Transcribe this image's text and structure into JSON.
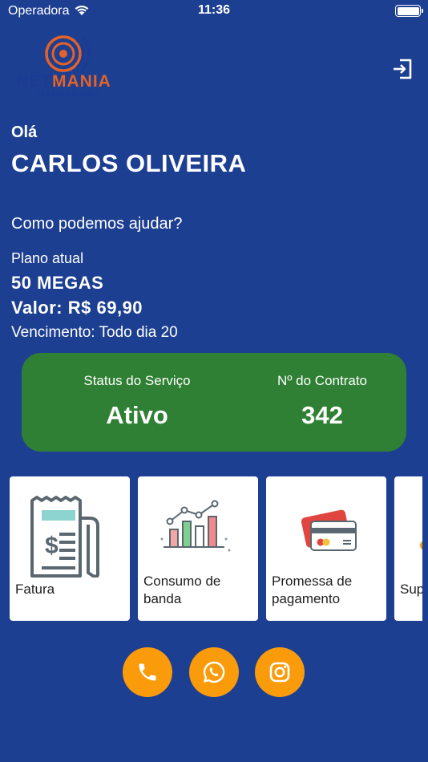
{
  "status_bar": {
    "carrier": "Operadora",
    "time": "11:36"
  },
  "logo": {
    "primary": "NET",
    "accent": "MANIA",
    "sub": "MANGABEIRA"
  },
  "header": {
    "logout_icon": "logout-icon"
  },
  "user": {
    "greeting": "Olá",
    "name": "CARLOS OLIVEIRA",
    "prompt": "Como podemos ajudar?"
  },
  "plan": {
    "label": "Plano atual",
    "name": "50 MEGAS",
    "value": "Valor: R$ 69,90",
    "due": "Vencimento: Todo dia 20"
  },
  "service_card": {
    "status_label": "Status do Serviço",
    "status_value": "Ativo",
    "contract_label": "Nº do Contrato",
    "contract_value": "342"
  },
  "tiles": [
    {
      "label": "Fatura",
      "icon": "invoice-icon"
    },
    {
      "label": "Consumo de\nbanda",
      "icon": "bar-chart-icon"
    },
    {
      "label": "Promessa de\npagamento",
      "icon": "credit-card-icon"
    },
    {
      "label": "Sup",
      "icon": "support-icon"
    }
  ],
  "actions": [
    {
      "icon": "phone-icon"
    },
    {
      "icon": "whatsapp-icon"
    },
    {
      "icon": "instagram-icon"
    }
  ],
  "colors": {
    "background": "#1d3f91",
    "card_green": "#2f8034",
    "fab_orange": "#f99b0a",
    "logo_orange": "#e2622a"
  }
}
